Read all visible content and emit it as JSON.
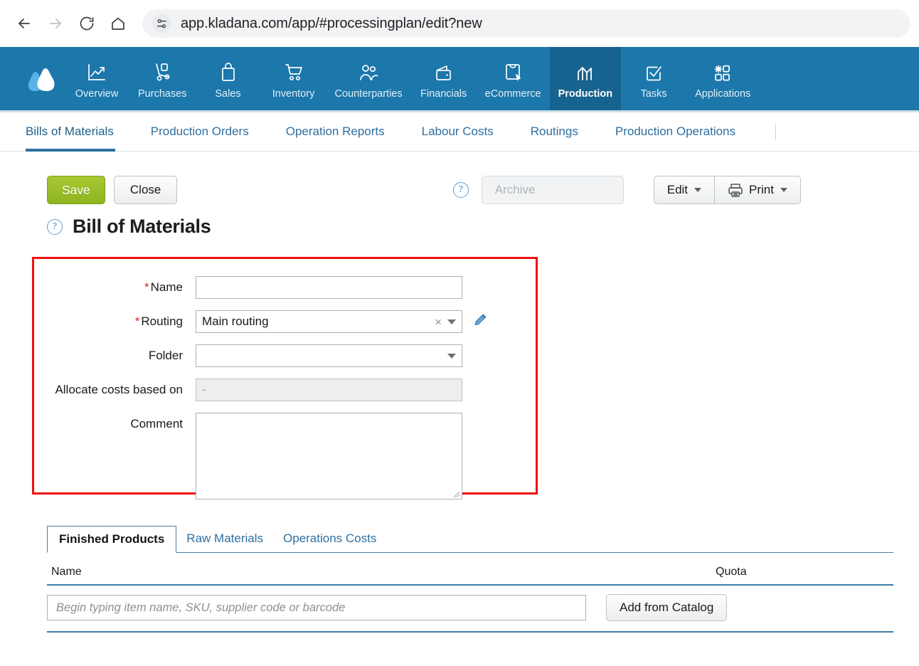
{
  "browser": {
    "back_icon": "back-arrow-icon",
    "forward_icon": "forward-arrow-icon",
    "reload_icon": "reload-icon",
    "home_icon": "home-icon",
    "site_info_icon": "site-settings-icon",
    "url": "app.kladana.com/app/#processingplan/edit?new"
  },
  "appnav": {
    "brand": "kladana-logo",
    "accent": "#1c77ab",
    "accent_active": "#17638f",
    "items": [
      {
        "label": "Overview",
        "icon": "chart-line-icon",
        "active": false
      },
      {
        "label": "Purchases",
        "icon": "hand-truck-icon",
        "active": false
      },
      {
        "label": "Sales",
        "icon": "shopping-bag-icon",
        "active": false
      },
      {
        "label": "Inventory",
        "icon": "cart-icon",
        "active": false
      },
      {
        "label": "Counterparties",
        "icon": "people-icon",
        "active": false
      },
      {
        "label": "Financials",
        "icon": "wallet-icon",
        "active": false
      },
      {
        "label": "eCommerce",
        "icon": "storefront-icon",
        "active": false
      },
      {
        "label": "Production",
        "icon": "bar-chart-icon",
        "active": true
      },
      {
        "label": "Tasks",
        "icon": "checkbox-icon",
        "active": false
      },
      {
        "label": "Applications",
        "icon": "apps-grid-icon",
        "active": false
      }
    ]
  },
  "subnav": {
    "items": [
      {
        "label": "Bills of Materials",
        "active": true
      },
      {
        "label": "Production Orders",
        "active": false
      },
      {
        "label": "Operation Reports",
        "active": false
      },
      {
        "label": "Labour Costs",
        "active": false
      },
      {
        "label": "Routings",
        "active": false
      },
      {
        "label": "Production Operations",
        "active": false
      }
    ]
  },
  "toolbar": {
    "save_label": "Save",
    "close_label": "Close",
    "help_glyph": "?",
    "archive_label": "Archive",
    "edit_label": "Edit",
    "print_label": "Print"
  },
  "page": {
    "help_glyph": "?",
    "title": "Bill of Materials",
    "highlight_color": "#f01010"
  },
  "form": {
    "fields": [
      {
        "label": "Name",
        "required": true,
        "value": "",
        "type": "text"
      },
      {
        "label": "Routing",
        "required": true,
        "value": "Main routing",
        "type": "select-clearable"
      },
      {
        "label": "Folder",
        "required": false,
        "value": "",
        "type": "select"
      },
      {
        "label": "Allocate costs based on",
        "required": false,
        "value": "-",
        "type": "disabled"
      },
      {
        "label": "Comment",
        "required": false,
        "value": "",
        "type": "textarea"
      }
    ],
    "routing_clear_glyph": "×",
    "routing_edit_icon": "pencil-icon"
  },
  "tabs": {
    "items": [
      {
        "label": "Finished Products",
        "active": true
      },
      {
        "label": "Raw Materials",
        "active": false
      },
      {
        "label": "Operations Costs",
        "active": false
      }
    ]
  },
  "table": {
    "columns": [
      "Name",
      "Quota"
    ],
    "search_placeholder": "Begin typing item name, SKU, supplier code or barcode",
    "add_from_catalog_label": "Add from Catalog"
  }
}
